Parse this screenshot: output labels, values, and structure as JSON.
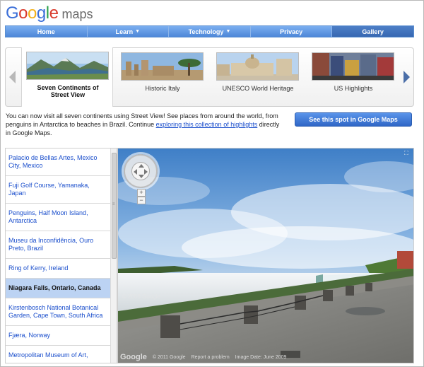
{
  "logo": {
    "brand": "Google",
    "product": "maps"
  },
  "nav": {
    "items": [
      {
        "label": "Home",
        "caret": false
      },
      {
        "label": "Learn",
        "caret": true
      },
      {
        "label": "Technology",
        "caret": true
      },
      {
        "label": "Privacy",
        "caret": false
      },
      {
        "label": "Gallery",
        "caret": false
      }
    ]
  },
  "carousel": {
    "collections": [
      {
        "label": "Seven Continents of Street View",
        "selected": true
      },
      {
        "label": "Historic Italy",
        "selected": false
      },
      {
        "label": "UNESCO World Heritage",
        "selected": false
      },
      {
        "label": "US Highlights",
        "selected": false
      }
    ]
  },
  "intro": {
    "text_before": "You can now visit all seven continents using Street View! See places from around the world, from penguins in Antarctica to beaches in Brazil. Continue ",
    "link": "exploring this collection of highlights",
    "text_after": " directly in Google Maps."
  },
  "cta": {
    "label": "See this spot in Google Maps"
  },
  "locations": [
    {
      "label": "Palacio de Bellas Artes, Mexico City, Mexico",
      "selected": false
    },
    {
      "label": "Fuji Golf Course, Yamanaka, Japan",
      "selected": false
    },
    {
      "label": "Penguins, Half Moon Island, Antarctica",
      "selected": false
    },
    {
      "label": "Museu da Inconfidência, Ouro Preto, Brazil",
      "selected": false
    },
    {
      "label": "Ring of Kerry, Ireland",
      "selected": false
    },
    {
      "label": "Niagara Falls, Ontario, Canada",
      "selected": true
    },
    {
      "label": "Kirstenbosch National Botanical Garden, Cape Town, South Africa",
      "selected": false
    },
    {
      "label": "Fjæra, Norway",
      "selected": false
    },
    {
      "label": "Metropolitan Museum of Art,",
      "selected": false
    }
  ],
  "streetview": {
    "zoom_in": "+",
    "zoom_out": "−",
    "footer_logo": "Google",
    "copyright": "© 2011 Google",
    "report": "Report a problem",
    "image_date": "Image Date: June 2009",
    "watermark": "© 2009 Google"
  },
  "colors": {
    "nav_bg": "#4d87d8",
    "nav_active": "#3667b2",
    "link": "#1a4ecc",
    "selected_row": "#bcd3f3",
    "cta": "#2f66c6"
  }
}
